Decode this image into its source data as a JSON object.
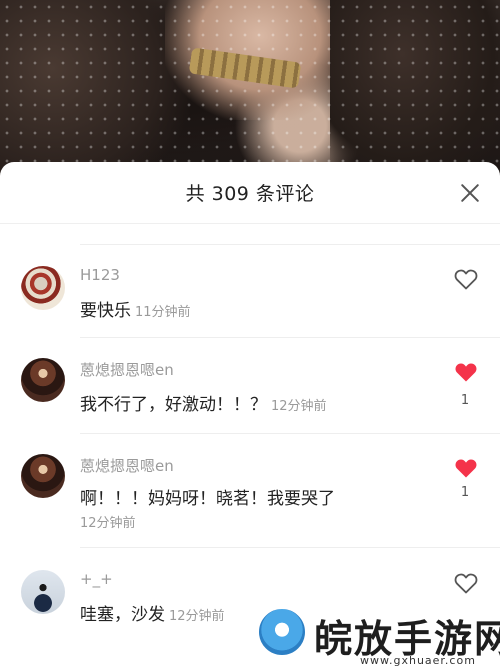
{
  "header": {
    "title": "共 309 条评论"
  },
  "comments": [
    {
      "username": "H123",
      "text": "要快乐",
      "time": "11分钟前",
      "liked": false,
      "like_count": ""
    },
    {
      "username": "蒽熄摁恩嗯en",
      "text": "我不行了，好激动！！？",
      "time": "12分钟前",
      "liked": true,
      "like_count": "1"
    },
    {
      "username": "蒽熄摁恩嗯en",
      "text": "啊！！！妈妈呀！晓茗！我要哭了",
      "time": "12分钟前",
      "liked": true,
      "like_count": "1"
    },
    {
      "username": "+_+",
      "text": "哇塞，沙发",
      "time": "12分钟前",
      "liked": false,
      "like_count": ""
    }
  ],
  "icons": {
    "close": "close-icon",
    "like": "heart-icon"
  },
  "colors": {
    "liked": "#f4334a",
    "unliked_stroke": "#555555",
    "username": "#9a9a9a"
  },
  "watermark": {
    "name": "皖放手游网",
    "url": "www.gxhuaer.com"
  }
}
